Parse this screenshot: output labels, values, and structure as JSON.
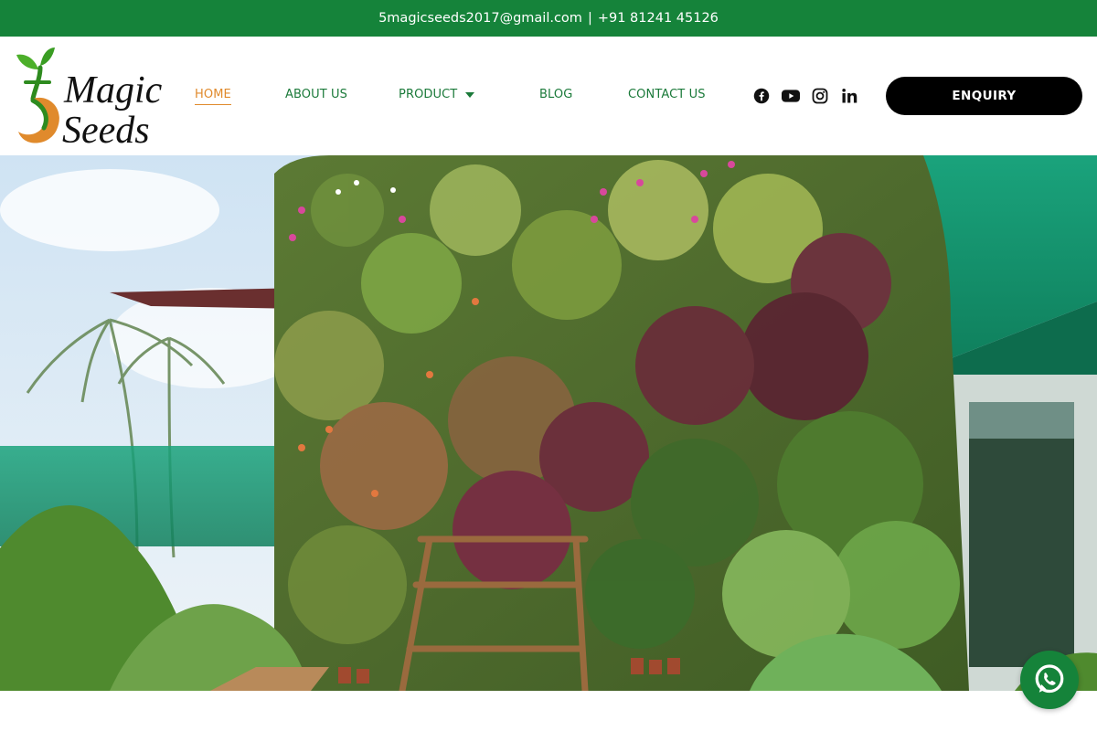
{
  "topbar": {
    "email": "5magicseeds2017@gmail.com",
    "separator": "|",
    "phone": "+91 81241 45126"
  },
  "brand": {
    "logo_line1": "Magic",
    "logo_line2": "Seeds",
    "logo_numeral": "5",
    "colors": {
      "green": "#15833a",
      "orange": "#e08a2c",
      "dark": "#111111"
    }
  },
  "nav": {
    "items": [
      {
        "label": "HOME",
        "active": true
      },
      {
        "label": "ABOUT US",
        "active": false
      },
      {
        "label": "PRODUCT",
        "active": false,
        "has_dropdown": true
      },
      {
        "label": "BLOG",
        "active": false
      },
      {
        "label": "CONTACT US",
        "active": false
      }
    ]
  },
  "social": [
    {
      "icon": "facebook-icon"
    },
    {
      "icon": "youtube-icon"
    },
    {
      "icon": "instagram-icon"
    },
    {
      "icon": "linkedin-icon"
    }
  ],
  "cta": {
    "enquiry_label": "ENQUIRY"
  },
  "hero": {
    "image": "vertical-garden-photo"
  },
  "floating": {
    "icon": "whatsapp-icon"
  }
}
